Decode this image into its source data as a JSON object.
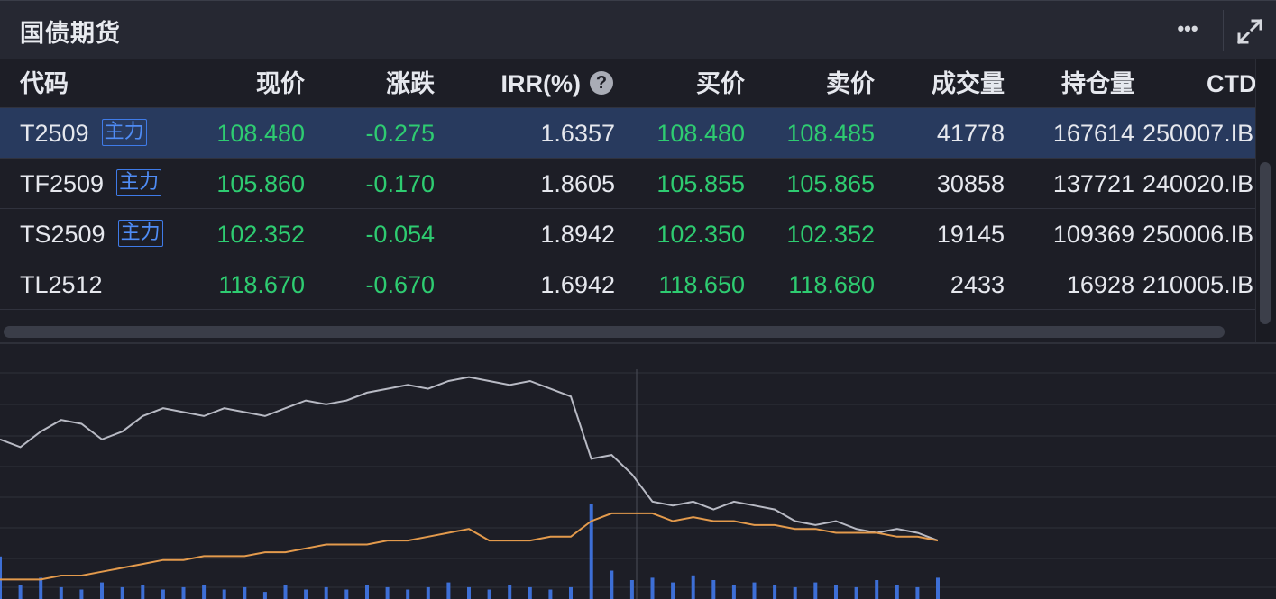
{
  "header": {
    "title": "国债期货",
    "more_icon": "more-icon",
    "expand_icon": "expand-icon"
  },
  "columns": {
    "code": "代码",
    "price": "现价",
    "change": "涨跌",
    "irr": "IRR(%)",
    "bid": "买价",
    "ask": "卖价",
    "volume": "成交量",
    "open_interest": "持仓量",
    "ctd": "CTD"
  },
  "rows": [
    {
      "code": "T2509",
      "tag": "主力",
      "price": "108.480",
      "change": "-0.275",
      "irr": "1.6357",
      "bid": "108.480",
      "ask": "108.485",
      "volume": "41778",
      "open_interest": "167614",
      "ctd": "250007.IB"
    },
    {
      "code": "TF2509",
      "tag": "主力",
      "price": "105.860",
      "change": "-0.170",
      "irr": "1.8605",
      "bid": "105.855",
      "ask": "105.865",
      "volume": "30858",
      "open_interest": "137721",
      "ctd": "240020.IB"
    },
    {
      "code": "TS2509",
      "tag": "主力",
      "price": "102.352",
      "change": "-0.054",
      "irr": "1.8942",
      "bid": "102.350",
      "ask": "102.352",
      "volume": "19145",
      "open_interest": "109369",
      "ctd": "250006.IB"
    },
    {
      "code": "TL2512",
      "tag": "",
      "price": "118.670",
      "change": "-0.670",
      "irr": "1.6942",
      "bid": "118.650",
      "ask": "118.680",
      "volume": "2433",
      "open_interest": "16928",
      "ctd": "210005.IB"
    }
  ],
  "colors": {
    "down": "#2ecc71",
    "selected_row": "#283a5e",
    "tag": "#4f8cf5",
    "price_line": "#b8bac4",
    "avg_line": "#e39a4c",
    "volume_bar": "#3d6fd6"
  },
  "chart_data": {
    "type": "line",
    "title": "",
    "series": [
      {
        "values": [
          108.76,
          108.74,
          108.78,
          108.81,
          108.8,
          108.76,
          108.78,
          108.82,
          108.84,
          108.83,
          108.82,
          108.84,
          108.83,
          108.82,
          108.84,
          108.86,
          108.85,
          108.86,
          108.88,
          108.89,
          108.9,
          108.89,
          108.91,
          108.92,
          108.91,
          108.9,
          108.91,
          108.89,
          108.87,
          108.71,
          108.72,
          108.67,
          108.6,
          108.59,
          108.6,
          108.58,
          108.6,
          108.59,
          108.58,
          108.55,
          108.54,
          108.55,
          108.53,
          108.52,
          108.53,
          108.52,
          108.5
        ]
      },
      {
        "values": [
          108.4,
          108.4,
          108.4,
          108.41,
          108.41,
          108.42,
          108.43,
          108.44,
          108.45,
          108.45,
          108.46,
          108.46,
          108.46,
          108.47,
          108.47,
          108.48,
          108.49,
          108.49,
          108.49,
          108.5,
          108.5,
          108.51,
          108.52,
          108.53,
          108.5,
          108.5,
          108.5,
          108.51,
          108.51,
          108.55,
          108.57,
          108.57,
          108.57,
          108.55,
          108.56,
          108.55,
          108.55,
          108.54,
          108.54,
          108.53,
          108.53,
          108.52,
          108.52,
          108.52,
          108.51,
          108.51,
          108.5
        ]
      }
    ],
    "volume": [
      18,
      6,
      9,
      5,
      4,
      7,
      5,
      6,
      4,
      5,
      6,
      4,
      5,
      3,
      6,
      4,
      5,
      4,
      6,
      5,
      4,
      5,
      7,
      5,
      4,
      6,
      5,
      4,
      5,
      40,
      12,
      8,
      9,
      7,
      10,
      8,
      6,
      7,
      6,
      5,
      7,
      6,
      5,
      8,
      6,
      5,
      9
    ],
    "grid": true
  }
}
